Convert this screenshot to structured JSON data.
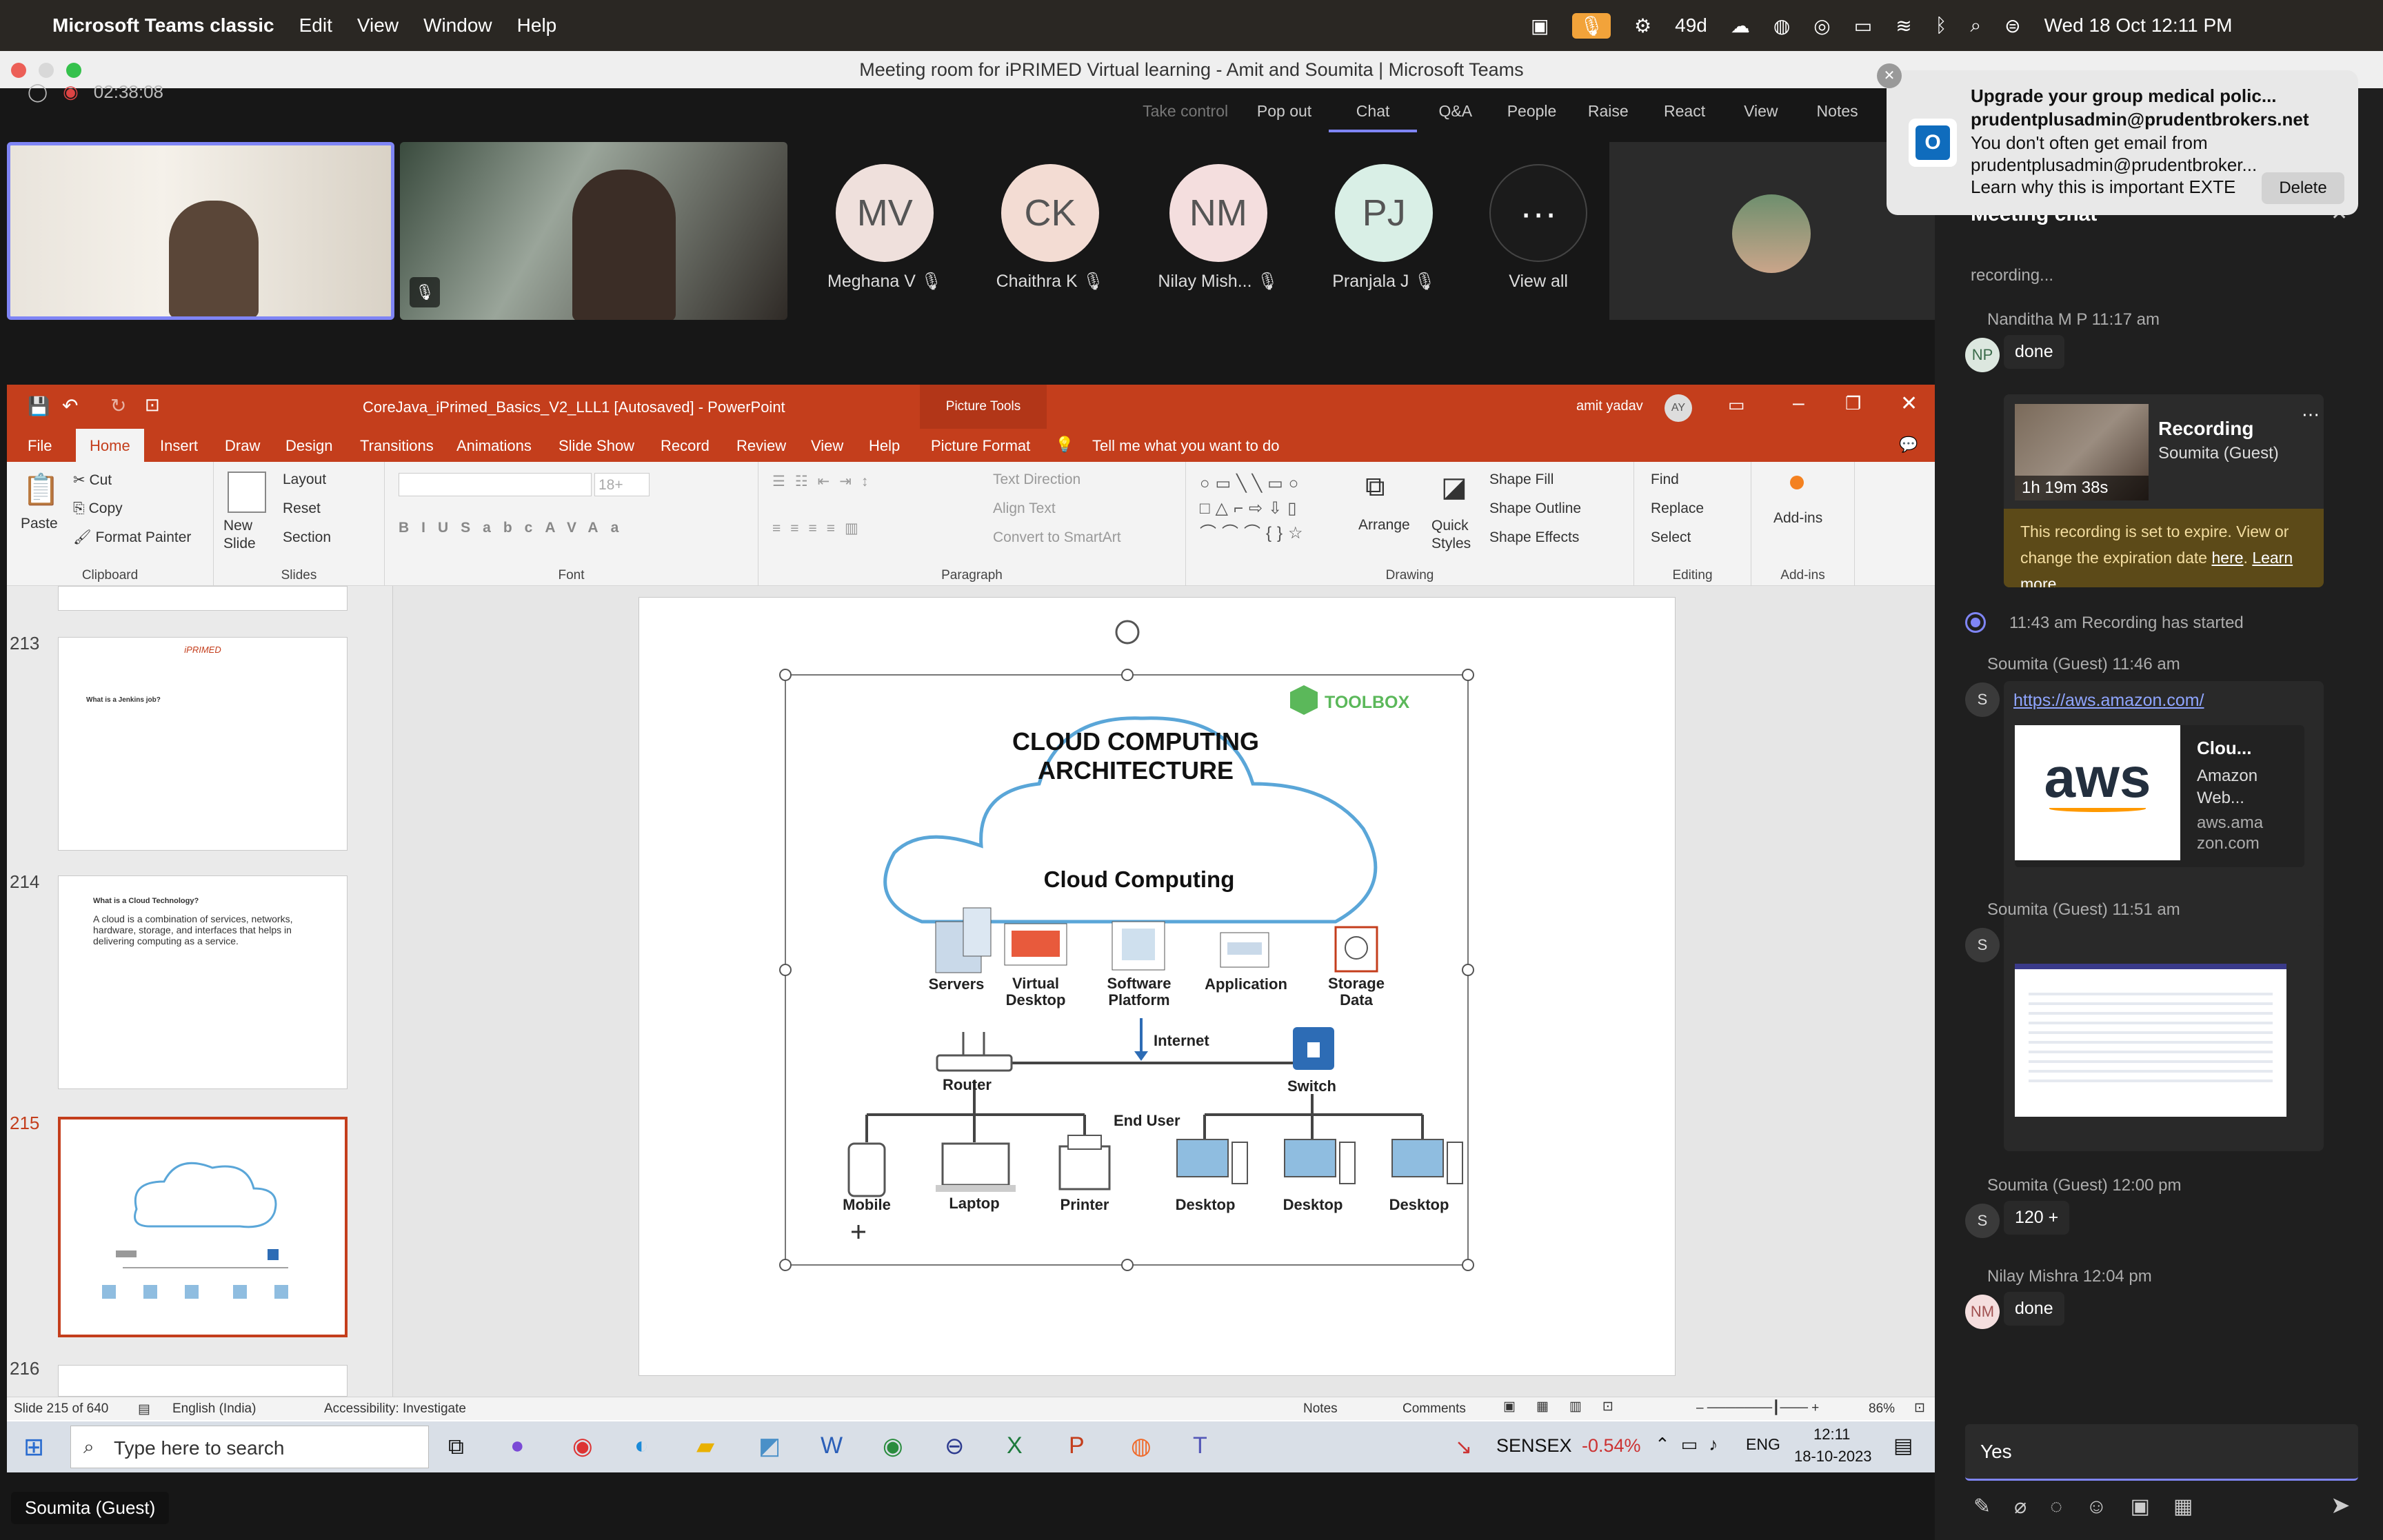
{
  "mac": {
    "app": "Microsoft Teams classic",
    "menus": [
      "Edit",
      "View",
      "Window",
      "Help"
    ],
    "weather": "49d",
    "datetime": "Wed 18 Oct  12:11 PM"
  },
  "window": {
    "title": "Meeting room for iPRIMED Virtual learning - Amit and Soumita | Microsoft Teams"
  },
  "meeting": {
    "timer": "02:38:08",
    "toolbar": [
      "Take control",
      "Pop out",
      "Chat",
      "Q&A",
      "People",
      "Raise",
      "React",
      "View",
      "Notes"
    ],
    "participants": [
      {
        "initials": "MV",
        "name": "Meghana V",
        "color": "#efe0dc"
      },
      {
        "initials": "CK",
        "name": "Chaithra K",
        "color": "#f3dcd3"
      },
      {
        "initials": "NM",
        "name": "Nilay Mish...",
        "color": "#f4dede"
      },
      {
        "initials": "PJ",
        "name": "Pranjala J",
        "color": "#d9efe6"
      }
    ],
    "view_all": "View all",
    "speaker_label": "Soumita (Guest)"
  },
  "toast": {
    "subject": "Upgrade your group medical polic...",
    "sender": "prudentplusadmin@prudentbrokers.net",
    "line1": "You don't often get email from",
    "line2": "prudentplusadmin@prudentbroker...",
    "line3": "Learn why this is important EXTE",
    "delete": "Delete"
  },
  "chat": {
    "title": "Meeting chat",
    "top_text": "recording...",
    "msg1": {
      "sender": "Nanditha M P",
      "time": "11:17 am",
      "initials": "NP",
      "text": "done"
    },
    "recording": {
      "title": "Recording",
      "by": "Soumita (Guest)",
      "duration": "1h 19m 38s",
      "expire": "This recording is set to expire. View or change the expiration date",
      "here": "here",
      "learn": "Learn more"
    },
    "event": {
      "time": "11:43 am",
      "text": "Recording has started"
    },
    "msg2": {
      "sender": "Soumita (Guest)",
      "time": "11:46 am",
      "link": "https://aws.amazon.com/",
      "card_title": "Clou...",
      "card_sub1": "Amazon",
      "card_sub2": "Web...",
      "card_domain1": "aws.ama",
      "card_domain2": "zon.com",
      "logo": "aws"
    },
    "msg3": {
      "sender": "Soumita (Guest)",
      "time": "11:51 am"
    },
    "msg4": {
      "sender": "Soumita (Guest)",
      "time": "12:00 pm",
      "text": "120 +"
    },
    "msg5": {
      "sender": "Nilay Mishra",
      "time": "12:04 pm",
      "initials": "NM",
      "text": "done"
    },
    "compose_value": "Yes",
    "avatar_s": "S"
  },
  "ppt": {
    "title": "CoreJava_iPrimed_Basics_V2_LLL1 [Autosaved]  -  PowerPoint",
    "context": "Picture Tools",
    "user": "amit yadav",
    "user_initials": "AY",
    "tabs": [
      "File",
      "Home",
      "Insert",
      "Draw",
      "Design",
      "Transitions",
      "Animations",
      "Slide Show",
      "Record",
      "Review",
      "View",
      "Help",
      "Picture Format"
    ],
    "tell": "Tell me what you want to do",
    "ribbon": {
      "paste": "Paste",
      "cut": "Cut",
      "copy": "Copy",
      "format_painter": "Format Painter",
      "clipboard": "Clipboard",
      "new_slide": "New Slide",
      "layout": "Layout",
      "reset": "Reset",
      "section": "Section",
      "slides": "Slides",
      "font": "Font",
      "font_size": "18+",
      "text_direction": "Text Direction",
      "align_text": "Align Text",
      "convert": "Convert to SmartArt",
      "paragraph": "Paragraph",
      "arrange": "Arrange",
      "quick_styles": "Quick Styles",
      "shape_fill": "Shape Fill",
      "shape_outline": "Shape Outline",
      "shape_effects": "Shape Effects",
      "drawing": "Drawing",
      "find": "Find",
      "replace": "Replace",
      "select": "Select",
      "editing": "Editing",
      "addins": "Add-ins"
    },
    "thumbs": [
      {
        "num": "213",
        "title": "What is a Jenkins job?",
        "logo": "iPRIMED"
      },
      {
        "num": "214",
        "title": "What is a Cloud Technology?",
        "body": "A cloud is a combination of services, networks, hardware, storage, and interfaces that helps in delivering computing as a service."
      },
      {
        "num": "215"
      },
      {
        "num": "216"
      }
    ],
    "status": {
      "slide": "Slide 215 of 640",
      "lang": "English (India)",
      "access": "Accessibility: Investigate",
      "notes": "Notes",
      "comments": "Comments",
      "zoom": "86%"
    }
  },
  "slide": {
    "brand": "TOOLBOX",
    "title1": "CLOUD COMPUTING",
    "title2": "ARCHITECTURE",
    "cloud": "Cloud Computing",
    "services": [
      "Servers",
      "Virtual Desktop",
      "Software Platform",
      "Application",
      "Storage Data"
    ],
    "internet": "Internet",
    "router": "Router",
    "switch": "Switch",
    "end_user": "End User",
    "devices": [
      "Mobile",
      "Laptop",
      "Printer",
      "Desktop",
      "Desktop",
      "Desktop"
    ]
  },
  "taskbar": {
    "search": "Type here to search",
    "ticker": "SENSEX",
    "change": "-0.54%",
    "lang": "ENG",
    "time": "12:11",
    "date": "18-10-2023"
  },
  "colors": {
    "ppt_red": "#c43e1c",
    "teams_purple": "#7f85f5",
    "cloud_blue": "#5aa6d8",
    "switch_blue": "#2d6cb5"
  }
}
